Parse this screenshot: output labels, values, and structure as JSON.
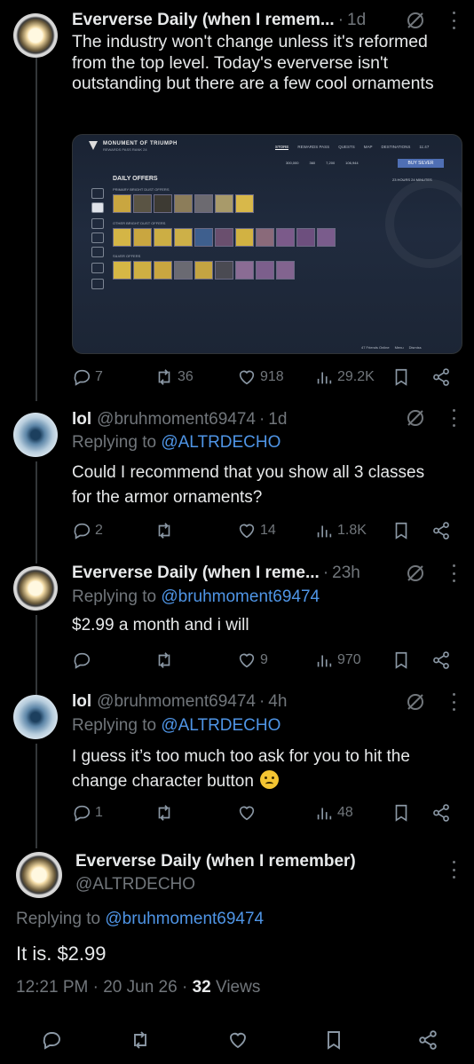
{
  "tweets": [
    {
      "name": "Eververse Daily (when I remem...",
      "time": "1d",
      "text": "The industry won't change unless it's reformed from the top level. Today's eververse isn't outstanding but there are a few cool ornaments",
      "replies": "7",
      "retweets": "36",
      "likes": "918",
      "views": "29.2K"
    },
    {
      "name": "lol",
      "handle": "@bruhmoment69474",
      "time": "1d",
      "replying_prefix": "Replying to",
      "replying_to": "@ALTRDECHO",
      "text": "Could I recommend that you show all 3 classes for the armor ornaments?",
      "replies": "2",
      "retweets": "",
      "likes": "14",
      "views": "1.8K"
    },
    {
      "name": "Eververse Daily (when I reme...",
      "time": "23h",
      "replying_prefix": "Replying to",
      "replying_to": "@bruhmoment69474",
      "text": "$2.99 a month and i will",
      "replies": "",
      "retweets": "",
      "likes": "9",
      "views": "970"
    },
    {
      "name": "lol",
      "handle": "@bruhmoment69474",
      "time": "4h",
      "replying_prefix": "Replying to",
      "replying_to": "@ALTRDECHO",
      "text_line1": "I guess it’s too much too ask for you to hit the",
      "text_line2": "change character button",
      "replies": "1",
      "retweets": "",
      "likes": "",
      "views": "48"
    }
  ],
  "game_screenshot": {
    "title": "MONUMENT OF TRIUMPH",
    "subtitle": "REWARDS PASS RANK 24",
    "nav": [
      "STORE",
      "REWARDS PASS",
      "QUESTS",
      "MAP",
      "DESTINATIONS",
      "11:47"
    ],
    "currencies": [
      "300,000",
      "360",
      "7,200",
      "106,944"
    ],
    "buy_button": "BUY SILVER",
    "timer": "23 HOURS 24 MINUTES",
    "heading": "DAILY OFFERS",
    "sections": [
      "PRIMARY BRIGHT DUST OFFERS",
      "OTHER BRIGHT DUST OFFERS",
      "SILVER OFFERS"
    ],
    "footer": [
      "47 Friends Online",
      "Menu",
      "Dismiss"
    ]
  },
  "main_tweet": {
    "name": "Eververse Daily (when I remember)",
    "handle": "@ALTRDECHO",
    "replying_prefix": "Replying to",
    "replying_to": "@bruhmoment69474",
    "text": "It is. $2.99",
    "time": "12:21 PM",
    "date": "20 Jun 26",
    "views_count": "32",
    "views_label": "Views"
  },
  "colors": {
    "background": "#000000",
    "text": "#e7e9ea",
    "muted": "#71767b",
    "link": "#4f95e6"
  }
}
